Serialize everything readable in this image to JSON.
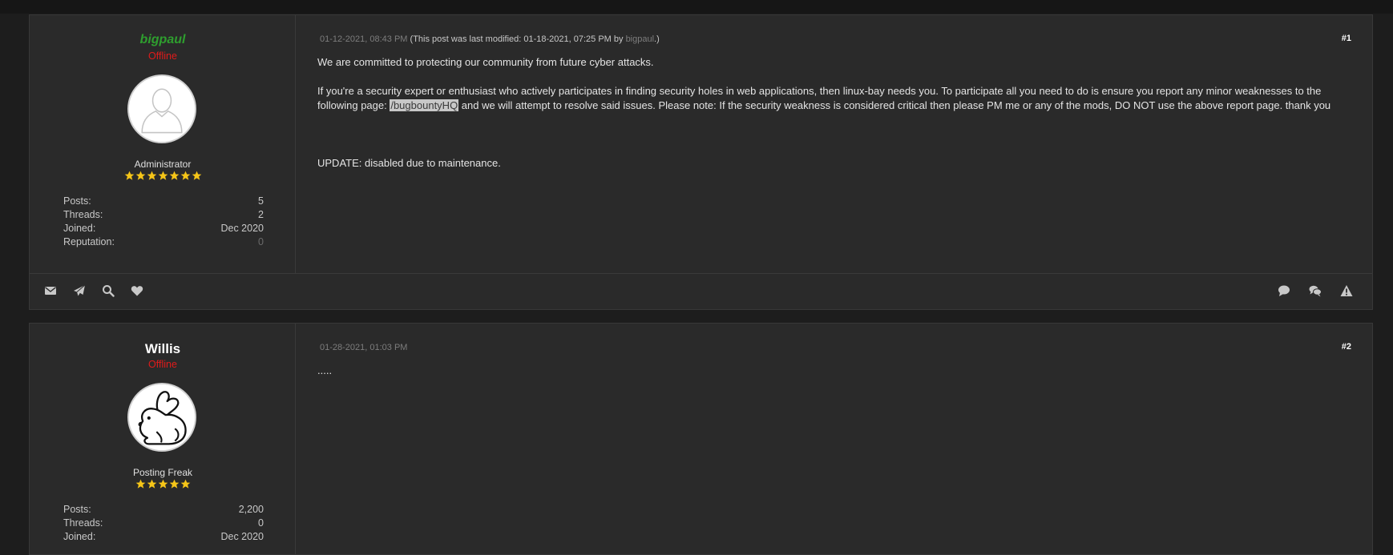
{
  "posts": [
    {
      "username": "bigpaul",
      "status": "Offline",
      "role": "Administrator",
      "stars": 7,
      "stats": [
        {
          "label": "Posts:",
          "value": "5"
        },
        {
          "label": "Threads:",
          "value": "2"
        },
        {
          "label": "Joined:",
          "value": "Dec 2020"
        },
        {
          "label": "Reputation:",
          "value": "0"
        }
      ],
      "date": "01-12-2021, 08:43 PM",
      "modified_prefix": "(This post was last modified: 01-18-2021, 07:25 PM by",
      "modified_by": "bigpaul",
      "modified_suffix": ".)",
      "number": "#1",
      "paragraph1": "We are committed to protecting our community from future cyber attacks.",
      "paragraph2_before": "If you're a security expert or enthusiast who actively participates in finding security holes in web applications, then linux-bay needs you. To participate all you need to do is ensure you report any minor weaknesses to the following page: ",
      "paragraph2_link": "/bugbountyHQ",
      "paragraph2_after": " and we will attempt to resolve said issues. Please note: If the security weakness is considered critical then please PM me or any of the mods, DO NOT use the above report page. thank you",
      "paragraph3": "UPDATE: disabled due to maintenance.",
      "footer_left_icons": [
        "envelope-icon",
        "paper-plane-icon",
        "search-icon",
        "heart-icon"
      ],
      "footer_right_icons": [
        "comment-icon",
        "comments-icon",
        "warning-icon"
      ]
    },
    {
      "username": "Willis",
      "status": "Offline",
      "role": "Posting Freak",
      "stars": 5,
      "stats": [
        {
          "label": "Posts:",
          "value": "2,200"
        },
        {
          "label": "Threads:",
          "value": "0"
        },
        {
          "label": "Joined:",
          "value": "Dec 2020"
        }
      ],
      "date": "01-28-2021, 01:03 PM",
      "number": "#2",
      "message": "....."
    }
  ],
  "colors": {
    "background": "#1d1d1d",
    "panel": "#2a2a2a",
    "admin_name": "#2e9e2e",
    "offline": "#e01b1b",
    "star": "#f5c518"
  }
}
